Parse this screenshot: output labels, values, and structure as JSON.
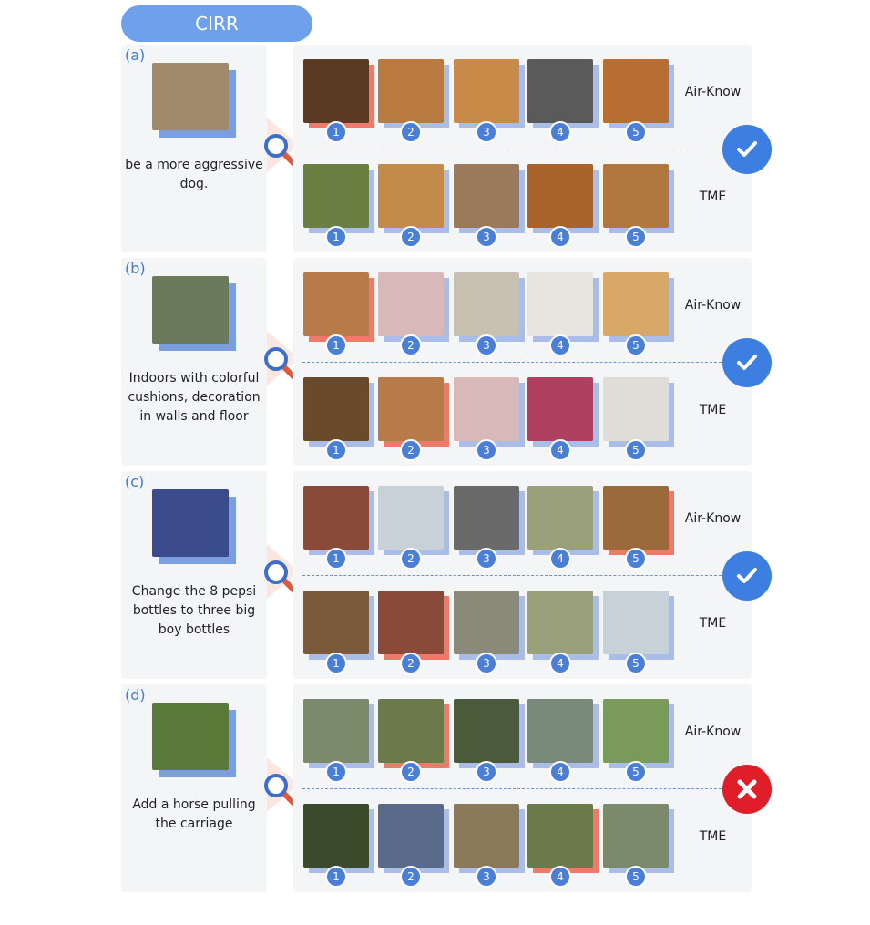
{
  "header": {
    "title": "CIRR"
  },
  "colors": {
    "accent": "#6fa0ea",
    "panel_bg": "#f4f5f7",
    "ok": "#3d7fe0",
    "bad": "#e01e2a",
    "rank_bg": "#4a7fd8"
  },
  "row_labels": {
    "top": "Air-Know",
    "bottom": "TME"
  },
  "ranks": [
    "1",
    "2",
    "3",
    "4",
    "5"
  ],
  "examples": [
    {
      "label": "(a)",
      "query_text": "be a more aggressive dog.",
      "query_color": "#a08a6a",
      "verdict": "correct",
      "verdict_icon": "check-icon",
      "air_know": [
        {
          "color": "#5a3a22",
          "highlight": true
        },
        {
          "color": "#b87a3e",
          "highlight": false
        },
        {
          "color": "#c88a48",
          "highlight": false
        },
        {
          "color": "#5a5a5a",
          "highlight": false
        },
        {
          "color": "#b86e32",
          "highlight": false
        }
      ],
      "tme": [
        {
          "color": "#6c7f42",
          "highlight": false
        },
        {
          "color": "#c48a4a",
          "highlight": false
        },
        {
          "color": "#9a7a5a",
          "highlight": false
        },
        {
          "color": "#a8642a",
          "highlight": false
        },
        {
          "color": "#b0783e",
          "highlight": false
        }
      ]
    },
    {
      "label": "(b)",
      "query_text": "Indoors with colorful cushions, decoration in walls and floor",
      "query_color": "#6a7a5a",
      "verdict": "correct",
      "verdict_icon": "check-icon",
      "air_know": [
        {
          "color": "#b87a48",
          "highlight": true
        },
        {
          "color": "#d8b8b8",
          "highlight": false
        },
        {
          "color": "#c8c0b0",
          "highlight": false
        },
        {
          "color": "#e8e4e0",
          "highlight": false
        },
        {
          "color": "#d8a868",
          "highlight": false
        }
      ],
      "tme": [
        {
          "color": "#6a4a2a",
          "highlight": false
        },
        {
          "color": "#b87a48",
          "highlight": true
        },
        {
          "color": "#d8b8b8",
          "highlight": false
        },
        {
          "color": "#b04060",
          "highlight": false
        },
        {
          "color": "#e0dcd8",
          "highlight": false
        }
      ]
    },
    {
      "label": "(c)",
      "query_text": "Change the 8 pepsi bottles to three big boy bottles",
      "query_color": "#3a4a8a",
      "verdict": "correct",
      "verdict_icon": "check-icon",
      "air_know": [
        {
          "color": "#8a4a3a",
          "highlight": false
        },
        {
          "color": "#c8d0d8",
          "highlight": false
        },
        {
          "color": "#6a6a6a",
          "highlight": false
        },
        {
          "color": "#9aa07a",
          "highlight": false
        },
        {
          "color": "#9a6a3a",
          "highlight": true
        }
      ],
      "tme": [
        {
          "color": "#7a5a3a",
          "highlight": false
        },
        {
          "color": "#8a4a3a",
          "highlight": true
        },
        {
          "color": "#8a8a7a",
          "highlight": false
        },
        {
          "color": "#9aa07a",
          "highlight": false
        },
        {
          "color": "#c8d0d8",
          "highlight": false
        }
      ]
    },
    {
      "label": "(d)",
      "query_text": "Add a horse pulling the carriage",
      "query_color": "#5a7a3a",
      "verdict": "wrong",
      "verdict_icon": "cross-icon",
      "air_know": [
        {
          "color": "#7a8a6a",
          "highlight": false
        },
        {
          "color": "#6a7a4a",
          "highlight": true
        },
        {
          "color": "#4a5a3a",
          "highlight": false
        },
        {
          "color": "#7a8a7a",
          "highlight": false
        },
        {
          "color": "#7a9a5a",
          "highlight": false
        }
      ],
      "tme": [
        {
          "color": "#3a4a2a",
          "highlight": false
        },
        {
          "color": "#5a6a8a",
          "highlight": false
        },
        {
          "color": "#8a7a5a",
          "highlight": false
        },
        {
          "color": "#6a7a4a",
          "highlight": true
        },
        {
          "color": "#7a8a6a",
          "highlight": false
        }
      ]
    }
  ]
}
